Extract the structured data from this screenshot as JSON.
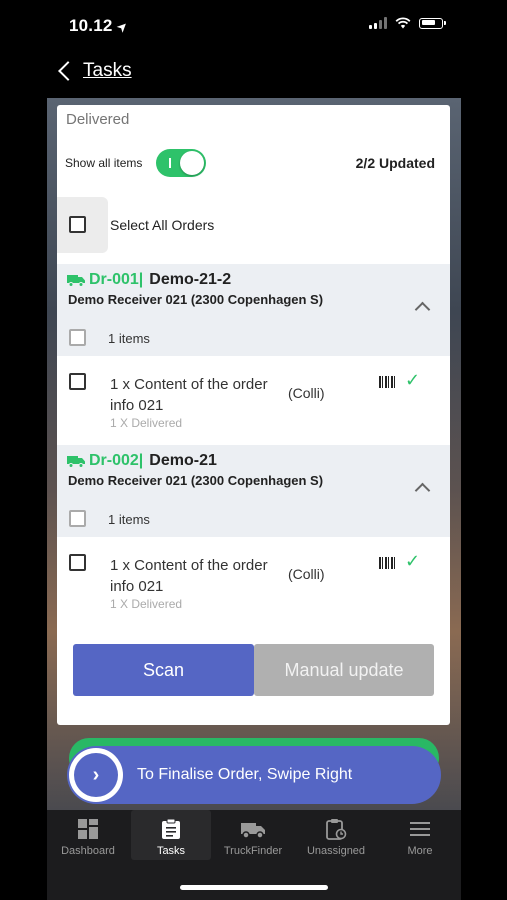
{
  "status_bar": {
    "time": "10.12"
  },
  "nav": {
    "back_label": "Tasks"
  },
  "panel": {
    "section_title": "Delivered",
    "show_all_label": "Show all items",
    "updated_text": "2/2 Updated",
    "select_all_label": "Select All Orders"
  },
  "orders": [
    {
      "id": "Dr-001|",
      "name": "Demo-21-2",
      "receiver": "Demo Receiver 021 (2300 Copenhagen S)",
      "items_count": "1 items",
      "line_text": "1 x Content of the order info 021",
      "line_unit": "(Colli)",
      "line_status": "1 X Delivered"
    },
    {
      "id": "Dr-002|",
      "name": "Demo-21",
      "receiver": "Demo Receiver 021 (2300 Copenhagen S)",
      "items_count": "1 items",
      "line_text": "1 x Content of the order info 021",
      "line_unit": "(Colli)",
      "line_status": "1 X Delivered"
    }
  ],
  "actions": {
    "scan_label": "Scan",
    "manual_label": "Manual update"
  },
  "swipe": {
    "label": "To Finalise Order, Swipe Right"
  },
  "tabs": [
    {
      "label": "Dashboard",
      "icon": "dashboard-icon"
    },
    {
      "label": "Tasks",
      "icon": "clipboard-icon",
      "active": true
    },
    {
      "label": "TruckFinder",
      "icon": "truck-icon"
    },
    {
      "label": "Unassigned",
      "icon": "clipboard-clock-icon"
    },
    {
      "label": "More",
      "icon": "menu-icon"
    }
  ],
  "colors": {
    "accent": "#5566c4",
    "success": "#2ec26a",
    "muted_button": "#b0b0b0"
  }
}
